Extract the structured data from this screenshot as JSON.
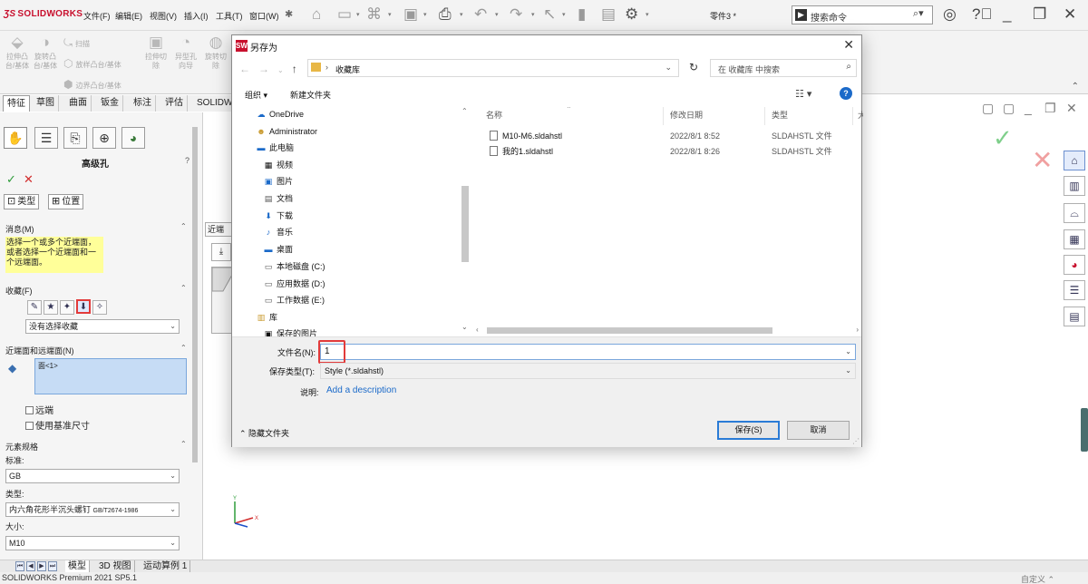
{
  "app": {
    "brand": "SOLIDWORKS",
    "menus": [
      "文件(F)",
      "编辑(E)",
      "视图(V)",
      "插入(I)",
      "工具(T)",
      "窗口(W)"
    ],
    "document_title": "零件3 *",
    "search_placeholder": "搜索命令"
  },
  "command_manager": {
    "buttons": [
      {
        "label": "拉伸凸台/基体",
        "icon": "extrude-boss-icon"
      },
      {
        "label": "旋转凸台/基体",
        "icon": "revolve-boss-icon"
      },
      {
        "label": "扫描",
        "icon": "sweep-icon"
      },
      {
        "label": "放样凸台/基体",
        "icon": "loft-icon"
      },
      {
        "label": "边界凸台/基体",
        "icon": "boundary-icon"
      },
      {
        "label": "拉伸切除",
        "icon": "extrude-cut-icon"
      },
      {
        "label": "异型孔向导",
        "icon": "hole-wizard-icon"
      },
      {
        "label": "旋转切除",
        "icon": "revolve-cut-icon"
      }
    ],
    "tabs": [
      "特征",
      "草图",
      "曲面",
      "钣金",
      "标注",
      "评估",
      "SOLIDWO"
    ]
  },
  "property_manager": {
    "title": "高级孔",
    "help": "?",
    "sub_tabs": [
      "类型",
      "位置"
    ],
    "sections": {
      "message": {
        "title": "消息(M)",
        "text": "选择一个或多个近端面，或者选择一个近端面和一个远端面。"
      },
      "favorites": {
        "title": "收藏(F)",
        "selected": "没有选择收藏"
      },
      "near_far": {
        "title": "近端面和远端面(N)",
        "selection": "面<1>",
        "options": [
          "远端",
          "使用基准尺寸"
        ]
      },
      "spec": {
        "title": "元素规格",
        "standard_label": "标准:",
        "standard": "GB",
        "type_label": "类型:",
        "type": "内六角花形半沉头螺钉",
        "type_std": "GB/T2674-1986",
        "size_label": "大小:",
        "size": "M10"
      }
    }
  },
  "graphics": {
    "near_tab": "近端"
  },
  "bottom_tabs": [
    "模型",
    "3D 视图",
    "运动算例 1"
  ],
  "status": {
    "left": "SOLIDWORKS Premium 2021 SP5.1",
    "right": "自定义"
  },
  "dialog": {
    "title": "另存为",
    "breadcrumb": "收藏库",
    "search_placeholder": "在 收藏库 中搜索",
    "commands": [
      "组织",
      "新建文件夹"
    ],
    "nav_items": [
      {
        "label": "OneDrive",
        "icon": "cloud-icon"
      },
      {
        "label": "Administrator",
        "icon": "user-icon"
      },
      {
        "label": "此电脑",
        "icon": "computer-icon"
      },
      {
        "label": "视频",
        "icon": "video-icon"
      },
      {
        "label": "图片",
        "icon": "picture-icon"
      },
      {
        "label": "文档",
        "icon": "document-icon"
      },
      {
        "label": "下载",
        "icon": "download-icon"
      },
      {
        "label": "音乐",
        "icon": "music-icon"
      },
      {
        "label": "桌面",
        "icon": "desktop-icon"
      },
      {
        "label": "本地磁盘 (C:)",
        "icon": "drive-icon"
      },
      {
        "label": "应用数据 (D:)",
        "icon": "drive-icon"
      },
      {
        "label": "工作数据 (E:)",
        "icon": "drive-icon"
      },
      {
        "label": "库",
        "icon": "library-icon"
      },
      {
        "label": "保存的图片",
        "icon": "picture-icon"
      }
    ],
    "columns": [
      "名称",
      "修改日期",
      "类型",
      "大"
    ],
    "files": [
      {
        "name": "M10-M6.sldahstl",
        "date": "2022/8/1 8:52",
        "type": "SLDAHSTL 文件"
      },
      {
        "name": "我的1.sldahstl",
        "date": "2022/8/1 8:26",
        "type": "SLDAHSTL 文件"
      }
    ],
    "filename_label": "文件名(N):",
    "filename_value": "1",
    "filetype_label": "保存类型(T):",
    "filetype_value": "Style (*.sldahstl)",
    "desc_label": "说明:",
    "desc_link": "Add a description",
    "hide_folders": "隐藏文件夹",
    "save_button": "保存(S)",
    "cancel_button": "取消"
  }
}
